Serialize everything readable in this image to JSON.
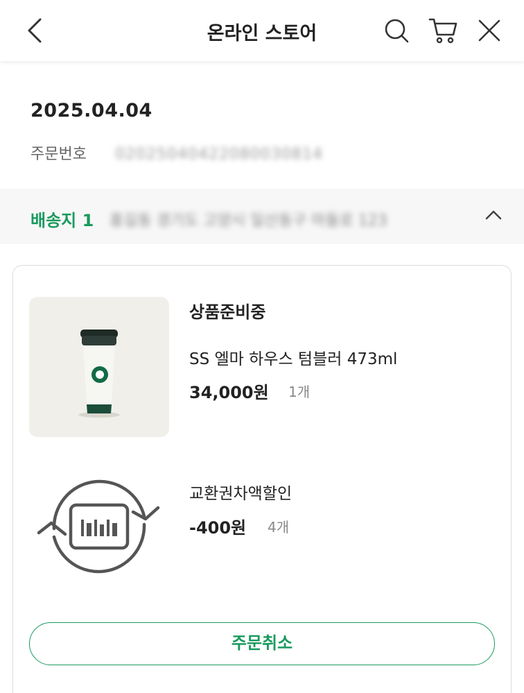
{
  "header": {
    "title": "온라인 스토어",
    "icons": [
      "chevron-left-icon",
      "search-icon",
      "cart-icon",
      "close-icon"
    ]
  },
  "order": {
    "date": "2025.04.04",
    "number_label": "주문번호",
    "number_value": "02025040422080030814"
  },
  "shipping": {
    "label": "배송지 1",
    "address": "홍길동 경기도 고양시 일산동구 마들로 123",
    "chevron": "chevron-up-icon"
  },
  "items": [
    {
      "status": "상품준비중",
      "name": "SS 엘마 하우스 텀블러 473ml",
      "price": "34,000원",
      "qty": "1개"
    }
  ],
  "discount": {
    "name": "교환권차액할인",
    "price": "-400원",
    "qty": "4개",
    "icon": "exchange-voucher-icon"
  },
  "actions": {
    "cancel_label": "주문취소"
  },
  "colors": {
    "accent": "#1a9a5e",
    "band": "#f7f7f7",
    "product_bg": "#f1efe9"
  }
}
